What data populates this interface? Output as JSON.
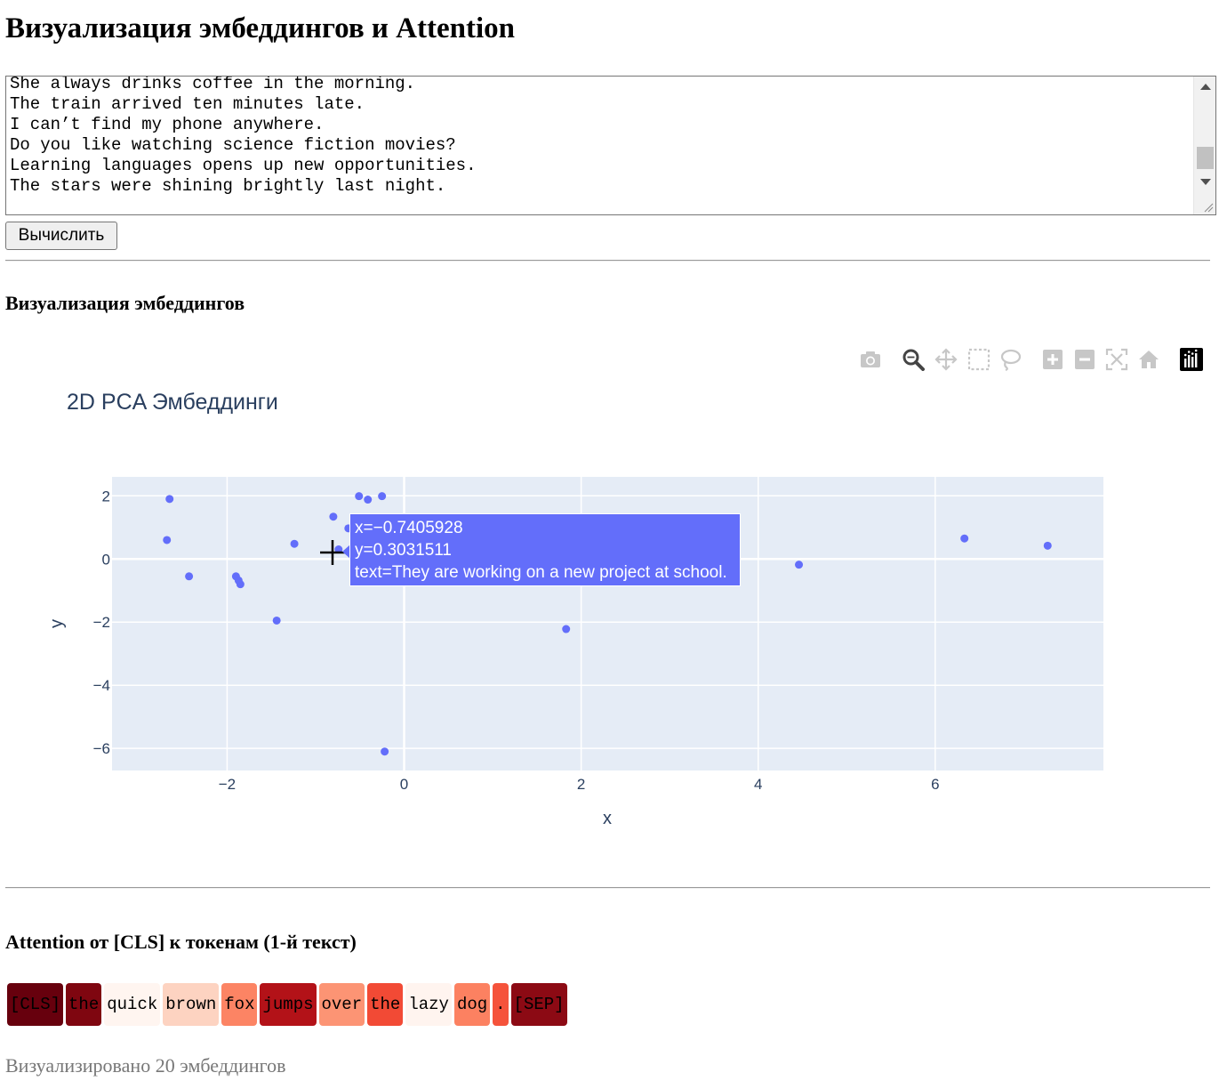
{
  "page_title": "Визуализация эмбеддингов и Attention",
  "input": {
    "lines": [
      "She always drinks coffee in the morning.",
      "The train arrived ten minutes late.",
      "I can’t find my phone anywhere.",
      "Do you like watching science fiction movies?",
      "Learning languages opens up new opportunities.",
      "The stars were shining brightly last night."
    ]
  },
  "compute_button_label": "Вычислить",
  "embeddings_section": {
    "heading": "Визуализация эмбеддингов"
  },
  "modebar": {
    "icons": [
      "camera-icon",
      "zoom-icon",
      "pan-icon",
      "box-select-icon",
      "lasso-icon",
      "zoom-in-icon",
      "zoom-out-icon",
      "autoscale-icon",
      "reset-axes-icon",
      "plotly-logo-icon"
    ]
  },
  "chart_data": {
    "type": "scatter",
    "title": "2D PCA Эмбеддинги",
    "xlabel": "x",
    "ylabel": "y",
    "xlim": [
      -3.3,
      7.9
    ],
    "ylim": [
      -6.7,
      2.6
    ],
    "xticks": [
      -2,
      0,
      2,
      4,
      6
    ],
    "yticks": [
      2,
      0,
      -2,
      -4,
      -6
    ],
    "tick_labels_x": [
      "−2",
      "0",
      "2",
      "4",
      "6"
    ],
    "tick_labels_y": [
      "2",
      "0",
      "−2",
      "−4",
      "−6"
    ],
    "grid": true,
    "marker_color": "#636efa",
    "plot_bg": "#e5ecf6",
    "points": [
      {
        "x": -2.65,
        "y": 1.9
      },
      {
        "x": -2.68,
        "y": 0.6
      },
      {
        "x": -2.43,
        "y": -0.55
      },
      {
        "x": -1.9,
        "y": -0.55
      },
      {
        "x": -1.87,
        "y": -0.68
      },
      {
        "x": -1.85,
        "y": -0.8
      },
      {
        "x": -1.44,
        "y": -1.95
      },
      {
        "x": -1.24,
        "y": 0.48
      },
      {
        "x": -0.8,
        "y": 1.34
      },
      {
        "x": -0.7405928,
        "y": 0.3031511
      },
      {
        "x": -0.63,
        "y": 0.97
      },
      {
        "x": -0.51,
        "y": 1.99
      },
      {
        "x": -0.41,
        "y": 1.88
      },
      {
        "x": -0.25,
        "y": 1.99
      },
      {
        "x": -0.22,
        "y": -6.1
      },
      {
        "x": 1.83,
        "y": -2.22
      },
      {
        "x": 4.46,
        "y": -0.18
      },
      {
        "x": 6.33,
        "y": 0.65
      },
      {
        "x": 7.27,
        "y": 0.42
      }
    ],
    "hover": {
      "x_text": "x=−0.7405928",
      "y_text": "y=0.3031511",
      "text": "text=They are working on a new project at school."
    }
  },
  "attention_section": {
    "heading": "Attention от [CLS] к токенам (1-й текст)",
    "tokens": [
      {
        "text": "[CLS]",
        "color": "#67000d"
      },
      {
        "text": "the",
        "color": "#7f0610"
      },
      {
        "text": "quick",
        "color": "#fff5f0"
      },
      {
        "text": "brown",
        "color": "#fdd3c1"
      },
      {
        "text": "fox",
        "color": "#fc8464"
      },
      {
        "text": "jumps",
        "color": "#b31218"
      },
      {
        "text": "over",
        "color": "#fc9474"
      },
      {
        "text": "the",
        "color": "#f24a35"
      },
      {
        "text": "lazy",
        "color": "#fff4ef"
      },
      {
        "text": "dog",
        "color": "#fc8161"
      },
      {
        "text": ".",
        "color": "#f5533b"
      },
      {
        "text": "[SEP]",
        "color": "#8c0a14"
      }
    ]
  },
  "footer_note": "Визуализировано 20 эмбеддингов"
}
